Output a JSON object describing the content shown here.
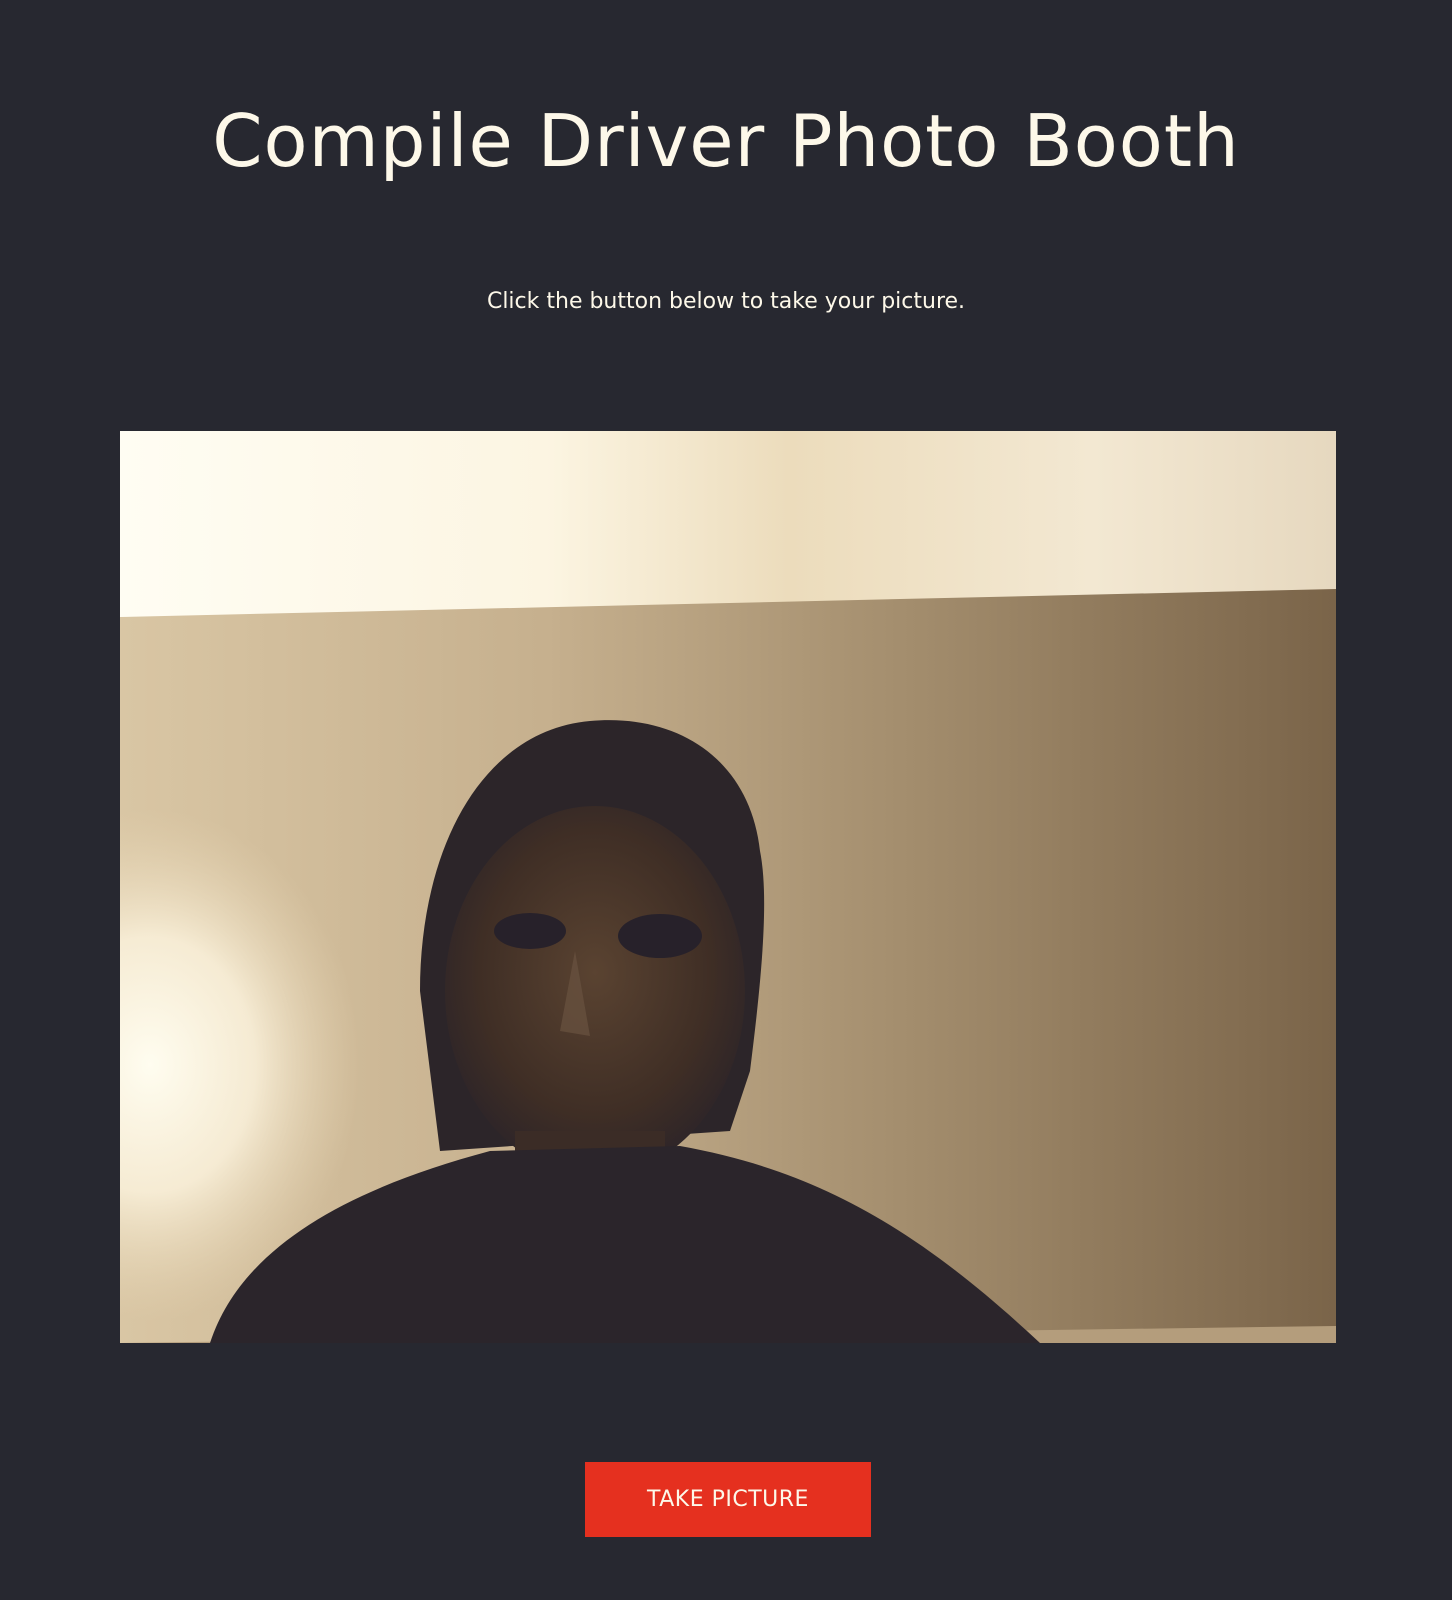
{
  "header": {
    "title": "Compile Driver Photo Booth"
  },
  "main": {
    "instructions": "Click the button below to take your picture.",
    "camera_feed": {
      "content": "webcam-video-frame"
    },
    "take_picture_label": "TAKE PICTURE"
  },
  "colors": {
    "background": "#272830",
    "text": "#fdf8e9",
    "button": "#e5301f"
  }
}
